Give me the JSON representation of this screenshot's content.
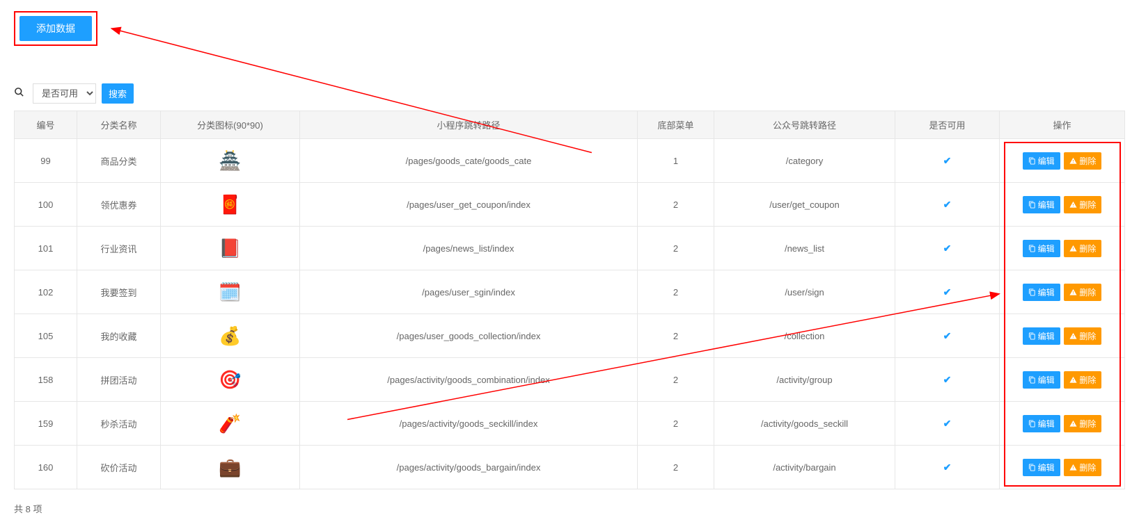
{
  "toolbar": {
    "add_label": "添加数据",
    "search_label": "搜索",
    "search_icon_name": "search-icon"
  },
  "filter": {
    "available_select_value": "是否可用"
  },
  "columns": {
    "id": "编号",
    "name": "分类名称",
    "icon": "分类图标(90*90)",
    "mini_path": "小程序跳转路径",
    "bottom_menu": "底部菜单",
    "mp_path": "公众号跳转路径",
    "available": "是否可用",
    "actions": "操作"
  },
  "actions": {
    "edit": "编辑",
    "delete": "删除"
  },
  "rows": [
    {
      "id": "99",
      "name": "商品分类",
      "icon_emoji": "🏯",
      "mini_path": "/pages/goods_cate/goods_cate",
      "bottom_menu": "1",
      "mp_path": "/category"
    },
    {
      "id": "100",
      "name": "领优惠券",
      "icon_emoji": "🧧",
      "mini_path": "/pages/user_get_coupon/index",
      "bottom_menu": "2",
      "mp_path": "/user/get_coupon"
    },
    {
      "id": "101",
      "name": "行业资讯",
      "icon_emoji": "📕",
      "mini_path": "/pages/news_list/index",
      "bottom_menu": "2",
      "mp_path": "/news_list"
    },
    {
      "id": "102",
      "name": "我要签到",
      "icon_emoji": "🗓️",
      "mini_path": "/pages/user_sgin/index",
      "bottom_menu": "2",
      "mp_path": "/user/sign"
    },
    {
      "id": "105",
      "name": "我的收藏",
      "icon_emoji": "💰",
      "mini_path": "/pages/user_goods_collection/index",
      "bottom_menu": "2",
      "mp_path": "/collection"
    },
    {
      "id": "158",
      "name": "拼团活动",
      "icon_emoji": "🎯",
      "mini_path": "/pages/activity/goods_combination/index",
      "bottom_menu": "2",
      "mp_path": "/activity/group"
    },
    {
      "id": "159",
      "name": "秒杀活动",
      "icon_emoji": "🧨",
      "mini_path": "/pages/activity/goods_seckill/index",
      "bottom_menu": "2",
      "mp_path": "/activity/goods_seckill"
    },
    {
      "id": "160",
      "name": "砍价活动",
      "icon_emoji": "💼",
      "mini_path": "/pages/activity/goods_bargain/index",
      "bottom_menu": "2",
      "mp_path": "/activity/bargain"
    }
  ],
  "footer": {
    "total_text": "共 8 项"
  },
  "annotations": {
    "color": "#f00"
  }
}
